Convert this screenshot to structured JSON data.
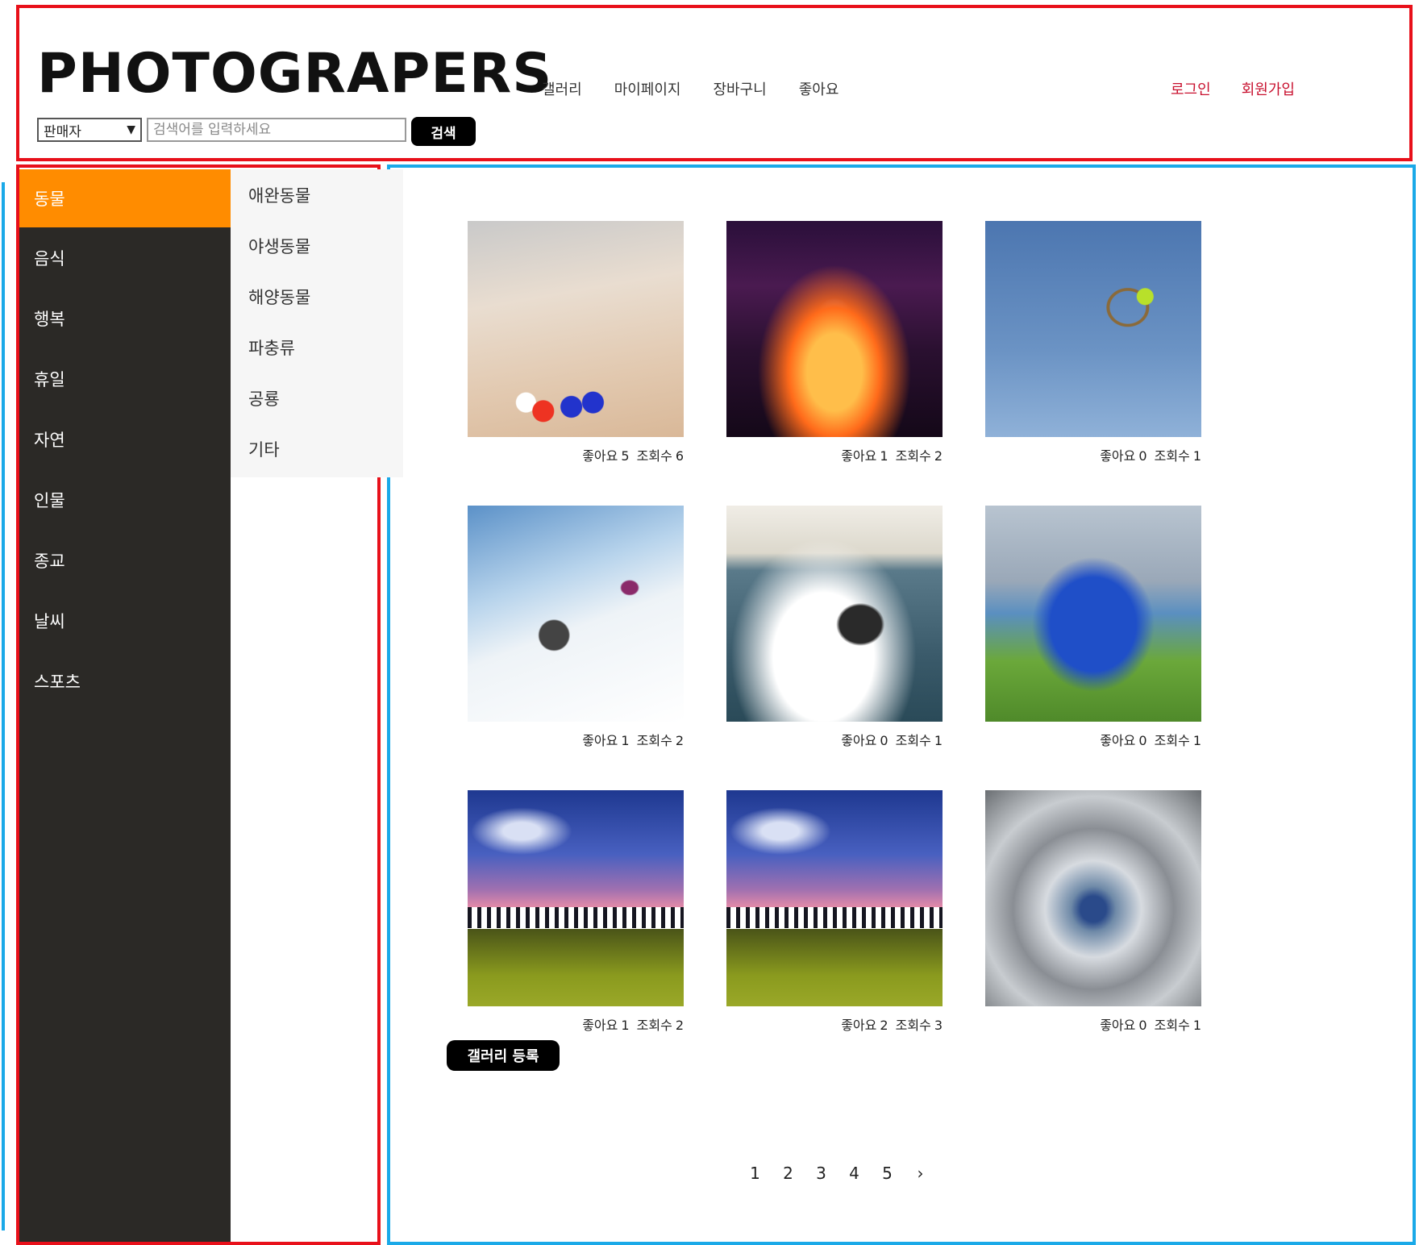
{
  "header": {
    "logo": "PHOTOGRAPERS",
    "search": {
      "filter_value": "판매자",
      "placeholder": "검색어를 입력하세요",
      "button_label": "검색"
    },
    "nav": [
      "갤러리",
      "마이페이지",
      "장바구니",
      "좋아요"
    ],
    "auth": {
      "login": "로그인",
      "signup": "회원가입"
    }
  },
  "sidebar": {
    "categories": [
      "동물",
      "음식",
      "행복",
      "휴일",
      "자연",
      "인물",
      "종교",
      "날씨",
      "스포츠"
    ],
    "active_index": 0,
    "subcategories": [
      "애완동물",
      "야생동물",
      "해양동물",
      "파충류",
      "공룡",
      "기타"
    ]
  },
  "gallery": {
    "like_label": "좋아요",
    "view_label": "조회수",
    "items": [
      {
        "likes": "5",
        "views": "6"
      },
      {
        "likes": "1",
        "views": "2"
      },
      {
        "likes": "0",
        "views": "1"
      },
      {
        "likes": "1",
        "views": "2"
      },
      {
        "likes": "0",
        "views": "1"
      },
      {
        "likes": "0",
        "views": "1"
      },
      {
        "likes": "1",
        "views": "2"
      },
      {
        "likes": "2",
        "views": "3"
      },
      {
        "likes": "0",
        "views": "1"
      }
    ],
    "register_label": "갤러리 등록"
  },
  "pagination": {
    "pages": [
      "1",
      "2",
      "3",
      "4",
      "5"
    ],
    "next": "›"
  },
  "colors": {
    "accent_orange": "#ff8c00",
    "sidebar_dark": "#2b2926",
    "auth_red": "#c8102e",
    "frame_red": "#e8101a",
    "frame_blue": "#1aa9e8"
  }
}
